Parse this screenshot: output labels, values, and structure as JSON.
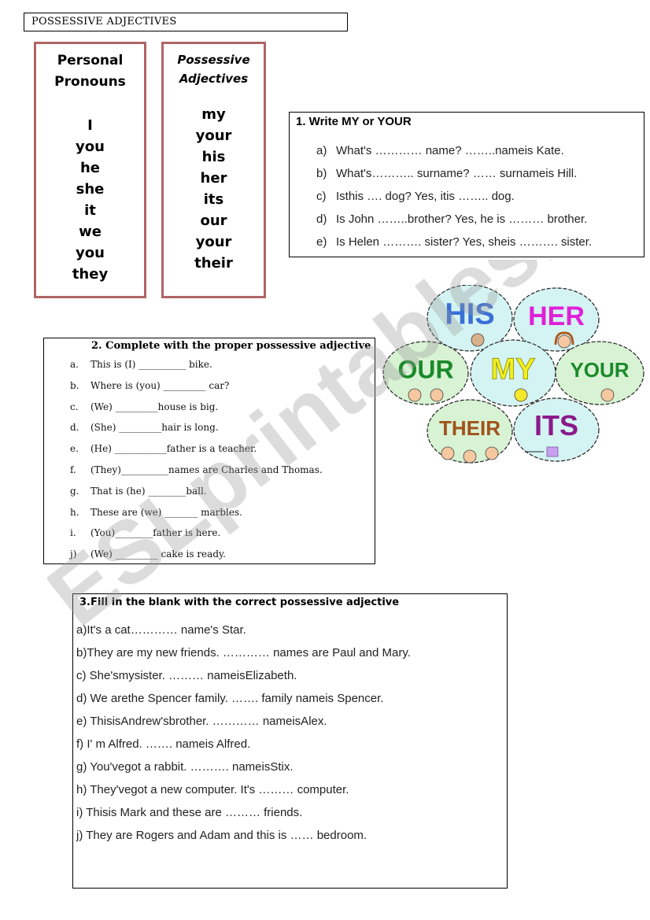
{
  "document": {
    "title": "POSSESSIVE ADJECTIVES",
    "watermark": "ESLprintables.com"
  },
  "pronoun_table": {
    "personal": {
      "heading_line1": "Personal",
      "heading_line2": "Pronouns",
      "items": [
        "I",
        "you",
        "he",
        "she",
        "it",
        "we",
        "you",
        "they"
      ]
    },
    "possessive": {
      "heading_line1": "Possessive",
      "heading_line2": "Adjectives",
      "items": [
        "my",
        "your",
        "his",
        "her",
        "its",
        "our",
        "your",
        "their"
      ]
    }
  },
  "exercise1": {
    "title": "1. Write MY or YOUR",
    "items": [
      {
        "label": "a)",
        "text": "What's ………… name? ……..nameis Kate."
      },
      {
        "label": "b)",
        "text": "What's……….. surname? …… surnameis Hill."
      },
      {
        "label": "c)",
        "text": "Isthis …. dog? Yes, itis …….. dog."
      },
      {
        "label": "d)",
        "text": "Is John ……..brother? Yes, he is ……… brother."
      },
      {
        "label": "e)",
        "text": "Is Helen ………. sister? Yes, sheis ………. sister."
      }
    ]
  },
  "bubbles": {
    "items": [
      {
        "word": "HIS",
        "color": "#3a6fd8",
        "bg": "#d4f3f3",
        "icon": "boy-face-icon"
      },
      {
        "word": "HER",
        "color": "#e020d8",
        "bg": "#d4f3f3",
        "icon": "girl-face-icon"
      },
      {
        "word": "OUR",
        "color": "#1a8a2a",
        "bg": "#d8f2d4",
        "icon": "two-faces-icon"
      },
      {
        "word": "MY",
        "color": "#f2f020",
        "bg": "#d4f3f3",
        "icon": "smiley-face-icon"
      },
      {
        "word": "YOUR",
        "color": "#1a8a2a",
        "bg": "#d8f2d4",
        "icon": "face-icon"
      },
      {
        "word": "THEIR",
        "color": "#a0521a",
        "bg": "#d8f2d4",
        "icon": "three-faces-icon"
      },
      {
        "word": "ITS",
        "color": "#8a1a8a",
        "bg": "#d4f3f3",
        "icon": "box-icon"
      }
    ]
  },
  "exercise2": {
    "title": "2.  Complete with the proper possessive adjective",
    "items": [
      {
        "label": "a.",
        "text": "This is (I) __________ bike."
      },
      {
        "label": "b.",
        "text": "Where is (you) _________ car?"
      },
      {
        "label": "c.",
        "text": "(We) _________house is big."
      },
      {
        "label": "d.",
        "text": "(She) _________hair is long."
      },
      {
        "label": "e.",
        "text": "(He) ___________father is a teacher."
      },
      {
        "label": "f.",
        "text": "(They)__________names are Charles and Thomas."
      },
      {
        "label": "g.",
        "text": "That is (he) ________ball."
      },
      {
        "label": "h.",
        "text": "These are (we) _______ marbles."
      },
      {
        "label": "i.",
        "text": "(You)________father is here."
      },
      {
        "label": "j)",
        "text": "(We) _________ cake is ready."
      }
    ]
  },
  "exercise3": {
    "title": "3.Fill in the blank with the correct possessive adjective",
    "items": [
      "a)It's a cat………… name's Star.",
      "b)They are my new friends.   ………… names are Paul and Mary.",
      " c) She'smysister.   ……… nameisElizabeth.",
      " d) We arethe Spencer family.   ……. family nameis  Spencer.",
      " e) ThisisAndrew'sbrother.    ………… nameisAlex.",
      " f) I' m Alfred.   ……. nameis Alfred.",
      " g) You'vegot a rabbit. ………. nameisStix.",
      " h) They'vegot a new computer. It's ……… computer.",
      " i) Thisis Mark and these are ……… friends.",
      " j) They are Rogers and Adam and this is …… bedroom."
    ]
  }
}
